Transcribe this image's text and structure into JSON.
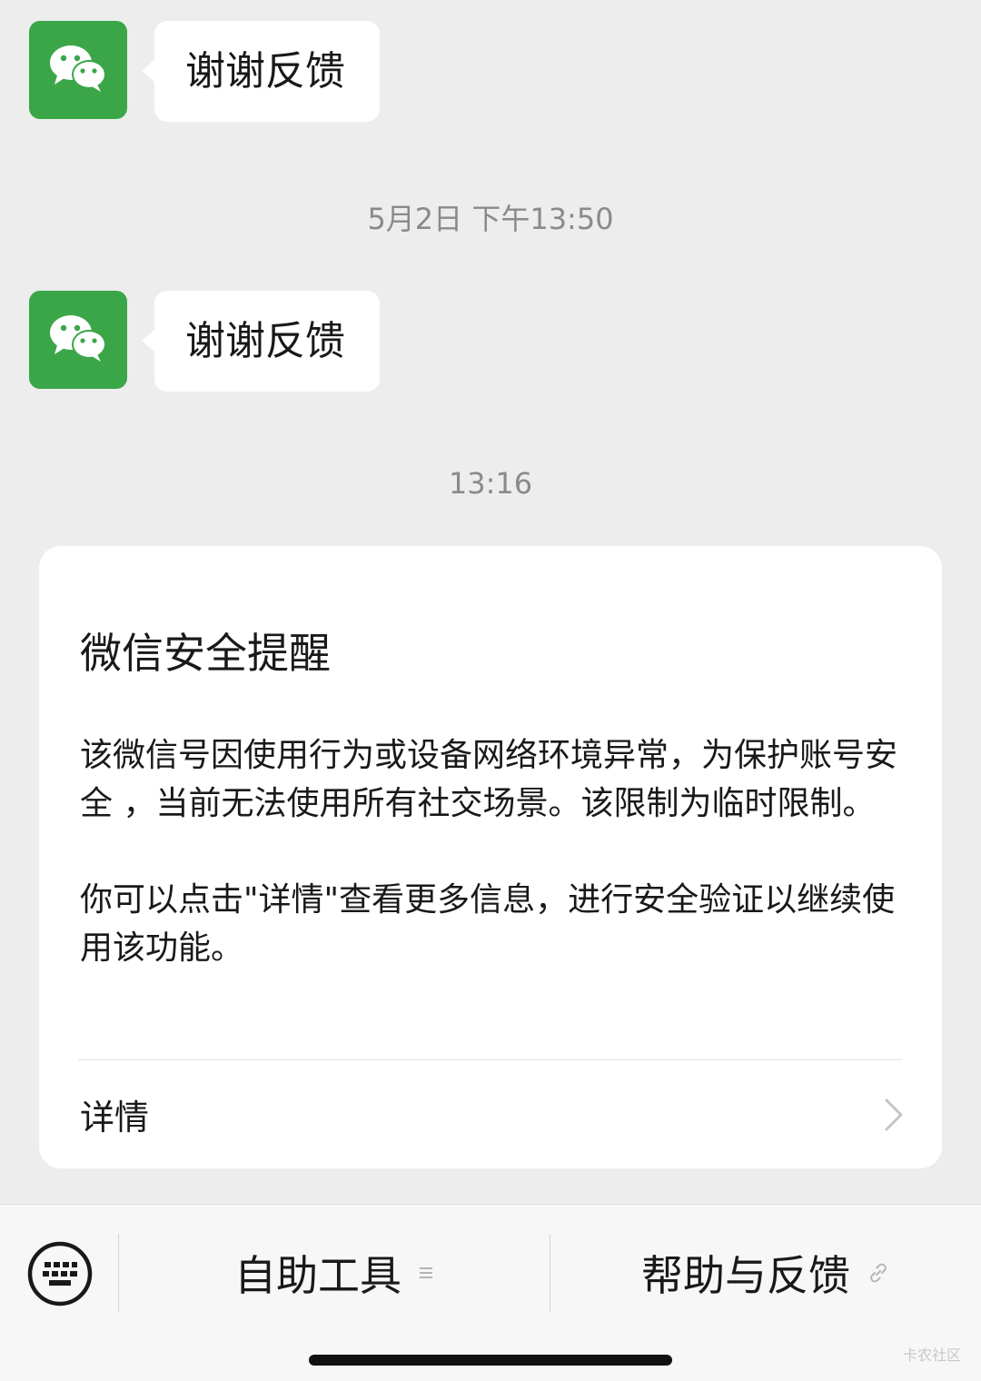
{
  "messages": [
    {
      "text": "谢谢反馈",
      "avatar_icon": "wechat-logo-icon"
    },
    {
      "text": "谢谢反馈",
      "avatar_icon": "wechat-logo-icon"
    }
  ],
  "timestamps": [
    "5月2日 下午13:50",
    "13:16"
  ],
  "security_card": {
    "title": "微信安全提醒",
    "paragraph_1": "该微信号因使用行为或设备网络环境异常，为保护账号安全 ，当前无法使用所有社交场景。该限制为临时限制。",
    "paragraph_2": "你可以点击\"详情\"查看更多信息，进行安全验证以继续使用该功能。",
    "detail_link": "详情",
    "detail_icon": "chevron-right-icon"
  },
  "bottom_menu": {
    "keyboard_icon": "keyboard-icon",
    "items": [
      {
        "label": "自助工具",
        "icon": "menu-lines-icon"
      },
      {
        "label": "帮助与反馈",
        "icon": "link-icon"
      }
    ]
  },
  "watermark": "卡农社区",
  "colors": {
    "background": "#ededed",
    "avatar_green": "#3aa648",
    "bubble": "#ffffff",
    "bottom_bar": "#f7f7f7"
  }
}
